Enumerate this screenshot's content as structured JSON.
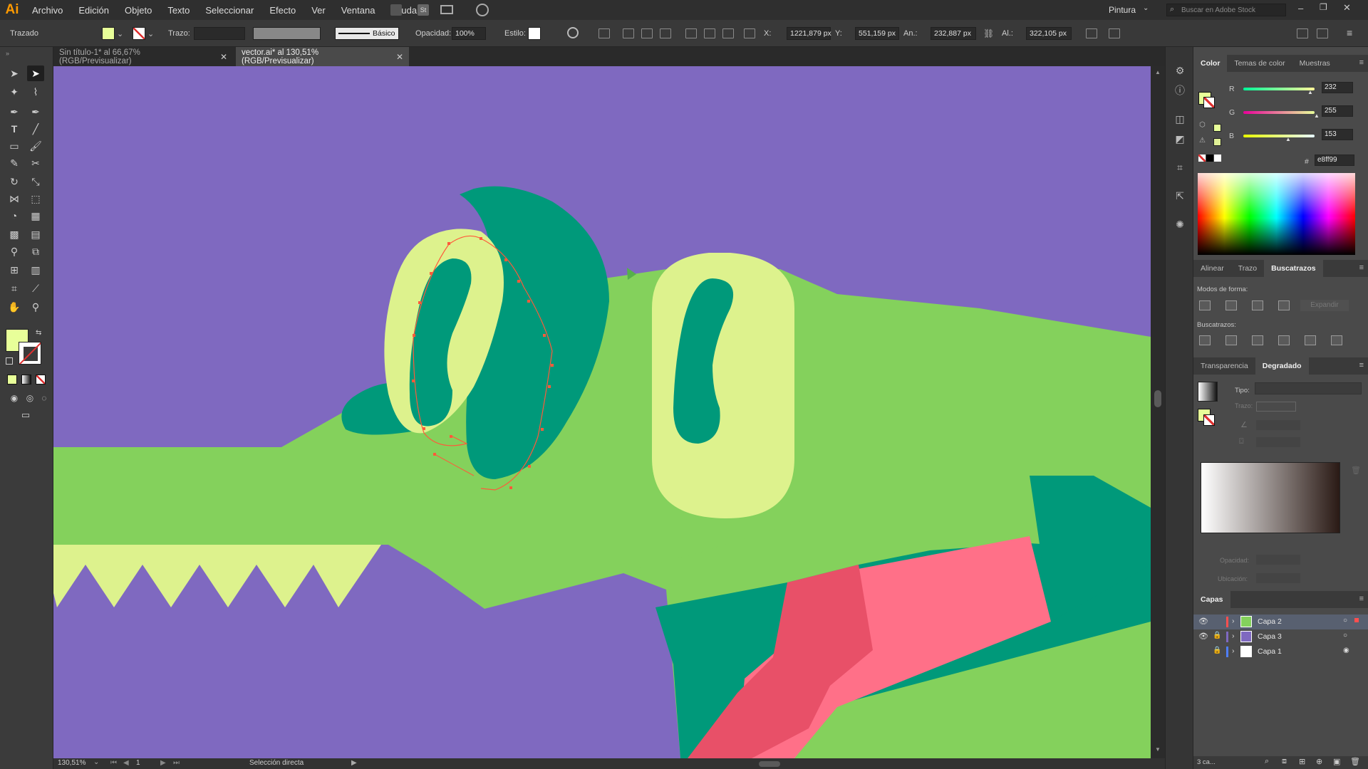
{
  "app": {
    "logo": "Ai"
  },
  "menu": [
    "Archivo",
    "Edición",
    "Objeto",
    "Texto",
    "Seleccionar",
    "Efecto",
    "Ver",
    "Ventana",
    "Ayuda"
  ],
  "workspace": {
    "name": "Pintura"
  },
  "search": {
    "placeholder": "Buscar en Adobe Stock"
  },
  "control": {
    "object_type": "Trazado",
    "fill_color": "#e8ff99",
    "stroke_label": "Trazo:",
    "brush_label": "Básico",
    "opacity_label": "Opacidad:",
    "opacity_value": "100%",
    "style_label": "Estilo:",
    "x_label": "X:",
    "x_value": "1221,879 px",
    "y_label": "Y:",
    "y_value": "551,159 px",
    "w_label": "An.:",
    "w_value": "232,887 px",
    "h_label": "Al.:",
    "h_value": "322,105 px"
  },
  "tabs": [
    {
      "label": "Sin título-1* al 66,67% (RGB/Previsualizar)",
      "active": false
    },
    {
      "label": "vector.ai* al 130,51% (RGB/Previsualizar)",
      "active": true
    }
  ],
  "status": {
    "zoom": "130,51%",
    "artboard": "1",
    "tool": "Selección directa"
  },
  "color_panel": {
    "tabs": [
      "Color",
      "Temas de color",
      "Muestras"
    ],
    "r_label": "R",
    "r": "232",
    "g_label": "G",
    "g": "255",
    "b_label": "B",
    "b": "153",
    "hex_label": "#",
    "hex": "e8ff99"
  },
  "align_panel": {
    "tabs": [
      "Alinear",
      "Trazo",
      "Buscatrazos"
    ],
    "shape_modes": "Modos de forma:",
    "expand": "Expandir",
    "pathfinders": "Buscatrazos:"
  },
  "gradient_panel": {
    "tabs": [
      "Transparencia",
      "Degradado"
    ],
    "type_label": "Tipo:",
    "stroke_label": "Trazo:",
    "opacity_label": "Opacidad:",
    "location_label": "Ubicación:"
  },
  "layers_panel": {
    "tab": "Capas",
    "layers": [
      {
        "name": "Capa 2",
        "color": "#ff4f4f",
        "visible": true,
        "locked": false,
        "selected": true
      },
      {
        "name": "Capa 3",
        "color": "#7f69c0",
        "visible": true,
        "locked": true,
        "selected": false
      },
      {
        "name": "Capa 1",
        "color": "#4f7fff",
        "visible": false,
        "locked": true,
        "selected": false
      }
    ],
    "count": "3 ca..."
  },
  "artwork_colors": {
    "background": "#7f69c0",
    "skin": "#84d15c",
    "dark": "#00997a",
    "light": "#ddf28d",
    "tongue": "#ff7088",
    "tongue_dark": "#e85068"
  }
}
